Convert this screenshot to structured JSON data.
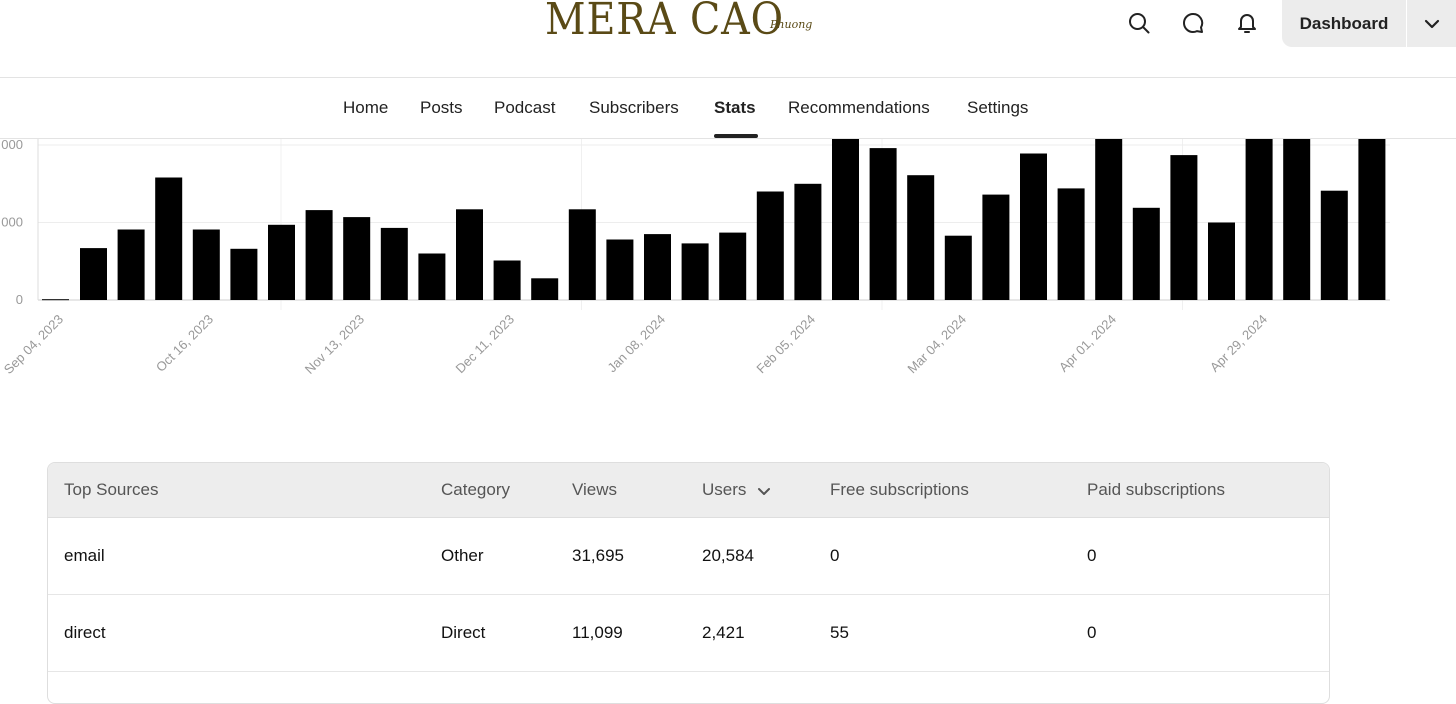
{
  "header": {
    "logo_text": "MERA CAO",
    "logo_script": "Phuong",
    "icons": [
      "search-icon",
      "chat-bubble-icon",
      "bell-icon",
      "chevron-down-icon"
    ],
    "dashboard_label": "Dashboard"
  },
  "nav": {
    "items": [
      {
        "label": "Home"
      },
      {
        "label": "Posts"
      },
      {
        "label": "Podcast"
      },
      {
        "label": "Subscribers"
      },
      {
        "label": "Stats",
        "active": true
      },
      {
        "label": "Recommendations"
      },
      {
        "label": "Settings"
      }
    ]
  },
  "chart_data": {
    "type": "bar",
    "ytick_labels": [
      "000",
      "000",
      "0"
    ],
    "yticks_data": [
      2000,
      1000,
      0
    ],
    "ylim": [
      0,
      2000
    ],
    "x_tick_labels": [
      "Sep 04, 2023",
      "Oct 16, 2023",
      "Nov 13, 2023",
      "Dec 11, 2023",
      "Jan 08, 2024",
      "Feb 05, 2024",
      "Mar 04, 2024",
      "Apr 01, 2024",
      "Apr 29, 2024"
    ],
    "values": [
      10,
      670,
      910,
      1580,
      910,
      660,
      970,
      1160,
      1070,
      930,
      600,
      1170,
      510,
      280,
      1170,
      780,
      850,
      730,
      870,
      1400,
      1500,
      2100,
      1960,
      1610,
      830,
      1360,
      1890,
      1440,
      2100,
      1190,
      1870,
      1000,
      2100,
      2100,
      1410,
      2100
    ],
    "bar_color": "#000000",
    "grid": true
  },
  "table": {
    "headers": [
      "Top Sources",
      "Category",
      "Views",
      "Users",
      "Free subscriptions",
      "Paid subscriptions"
    ],
    "sort_icon": "chevron-down-icon",
    "rows": [
      [
        "email",
        "Other",
        "31,695",
        "20,584",
        "0",
        "0"
      ],
      [
        "direct",
        "Direct",
        "11,099",
        "2,421",
        "55",
        "0"
      ]
    ]
  }
}
